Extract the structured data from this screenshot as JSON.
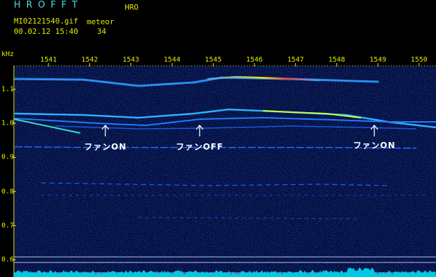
{
  "header": {
    "title": "HROFFT",
    "mode": "HRO",
    "filename": "MI02121540.gif",
    "datetime": "00.02.12 15:40",
    "meteor_label": "meteor",
    "meteor_count": "34"
  },
  "axis": {
    "unit": "kHz",
    "x_ticks": [
      "1541",
      "1542",
      "1543",
      "1544",
      "1545",
      "1546",
      "1547",
      "1548",
      "1549",
      "1550"
    ],
    "y_ticks": [
      "1.1",
      "1.0",
      "0.9",
      "0.8",
      "0.7",
      "0.6"
    ]
  },
  "annotations": [
    {
      "text": "ファンON"
    },
    {
      "text": "ファンOFF"
    },
    {
      "text": "ファンON"
    }
  ],
  "colors": {
    "background": "#000000",
    "header_text": "#e6e600",
    "title_text": "#55d8e6",
    "annotation": "#ffffff",
    "noise_floor": "#00c8e6"
  }
}
